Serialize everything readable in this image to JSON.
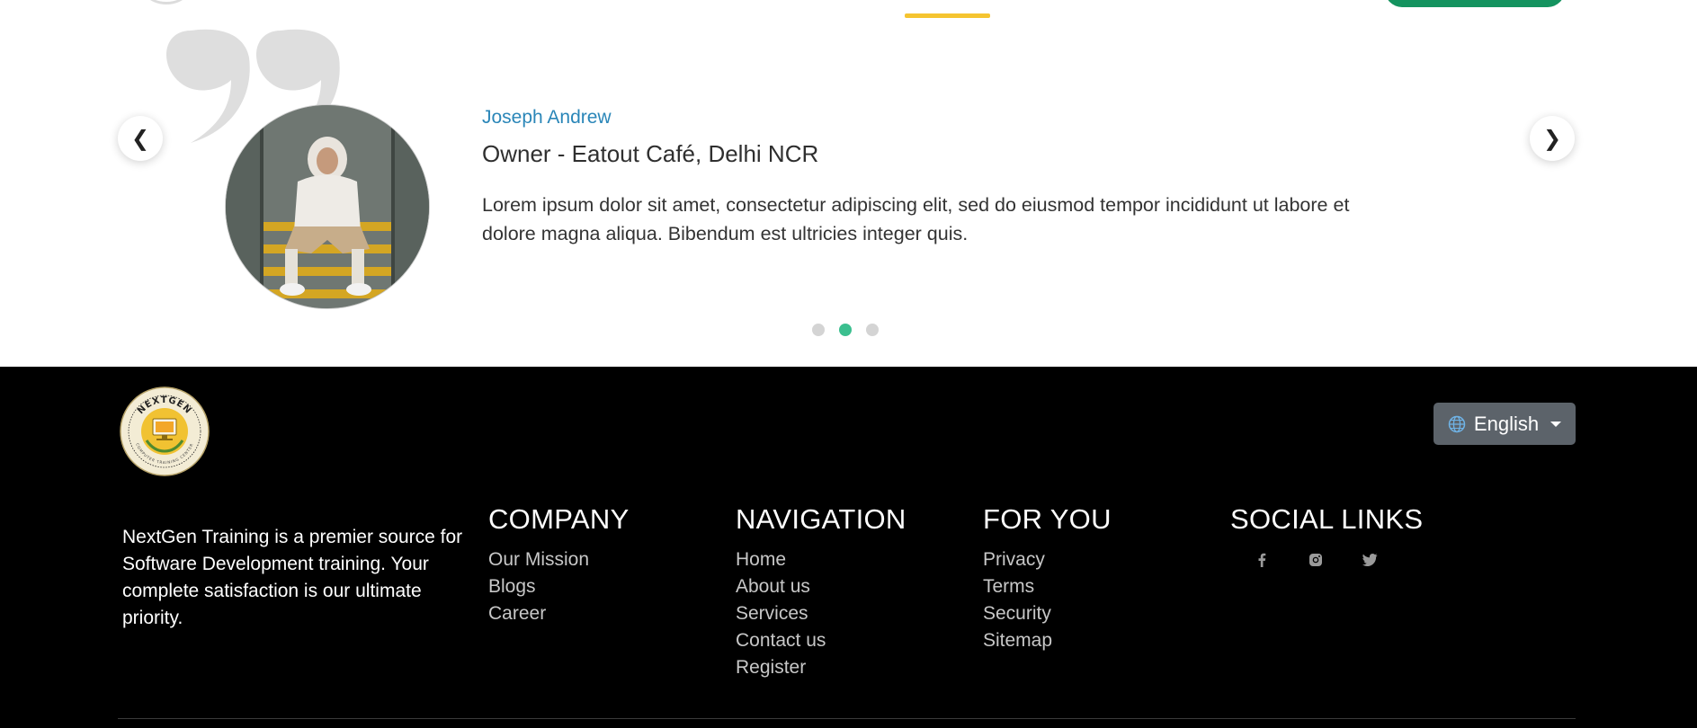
{
  "testimonial": {
    "name": "Joseph Andrew",
    "role": "Owner - Eatout Café, Delhi NCR",
    "quote": "Lorem ipsum dolor sit amet, consectetur adipiscing elit, sed do eiusmod tempor incididunt ut labore et dolore magna aliqua. Bibendum est ultricies integer quis.",
    "prev_icon": "❮",
    "next_icon": "❯",
    "slide_count": 3,
    "active_slide": 2
  },
  "colors": {
    "accent_yellow": "#f5c430",
    "accent_green": "#14935f",
    "name_blue": "#2a86b8",
    "dot_active": "#3bbf8f",
    "footer_bg": "#000000"
  },
  "footer": {
    "language": {
      "label": "English",
      "icon": "globe-icon"
    },
    "about": "NextGen Training is a premier source for Software Development training. Your complete satisfaction is our ultimate priority.",
    "columns": {
      "company": {
        "title": "COMPANY",
        "links": [
          "Our Mission",
          "Blogs",
          "Career"
        ]
      },
      "navigation": {
        "title": "NAVIGATION",
        "links": [
          "Home",
          "About us",
          "Services",
          "Contact us",
          "Register"
        ]
      },
      "for_you": {
        "title": "FOR YOU",
        "links": [
          "Privacy",
          "Terms",
          "Security",
          "Sitemap"
        ]
      },
      "social": {
        "title": "SOCIAL LINKS",
        "icons": [
          "facebook-icon",
          "instagram-icon",
          "twitter-icon"
        ]
      }
    }
  },
  "logo": {
    "ring_text_top": "NEXTGEN",
    "ring_text_bottom": "COMPUTER TRAINING CENTER"
  }
}
